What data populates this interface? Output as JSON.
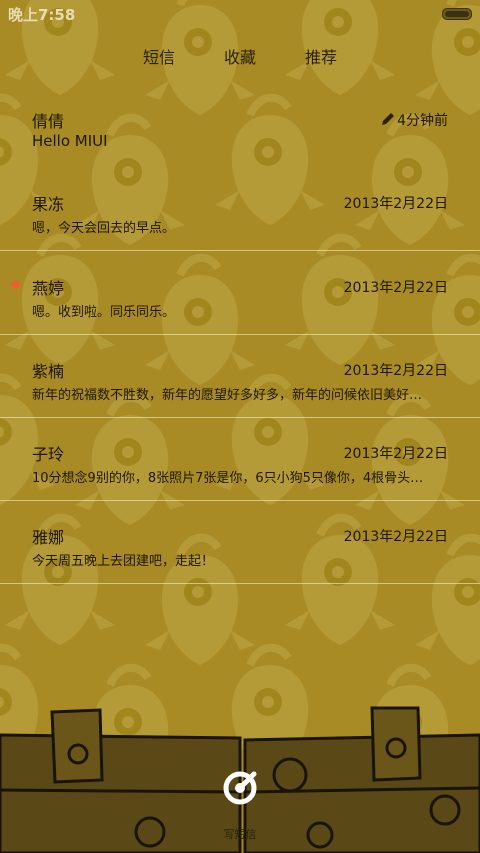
{
  "status_bar": {
    "time": "晚上7:58"
  },
  "tabs": [
    {
      "label": "短信",
      "active": true
    },
    {
      "label": "收藏",
      "active": false
    },
    {
      "label": "推荐",
      "active": false
    }
  ],
  "threads": [
    {
      "name": "倩倩",
      "time": "4分钟前",
      "preview": "Hello MIUI",
      "draft": true,
      "unread": false
    },
    {
      "name": "果冻",
      "time": "2013年2月22日",
      "preview": "嗯，今天会回去的早点。",
      "draft": false,
      "unread": false
    },
    {
      "name": "燕婷",
      "time": "2013年2月22日",
      "preview": "嗯。收到啦。同乐同乐。",
      "draft": false,
      "unread": true
    },
    {
      "name": "紫楠",
      "time": "2013年2月22日",
      "preview": "新年的祝福数不胜数，新年的愿望好多好多，新年的问候依旧美好…",
      "draft": false,
      "unread": false
    },
    {
      "name": "子玲",
      "time": "2013年2月22日",
      "preview": "10分想念9别的你，8张照片7张是你，6只小狗5只像你，4根骨头…",
      "draft": false,
      "unread": false
    },
    {
      "name": "雅娜",
      "time": "2013年2月22日",
      "preview": "今天周五晚上去团建吧，走起！",
      "draft": false,
      "unread": false
    }
  ],
  "compose": {
    "label": "写短信",
    "icon": "compose-icon"
  },
  "colors": {
    "background": "#a88b25",
    "pattern": "#b89d3a",
    "unread": "#e8622a",
    "text": "#1e1705"
  }
}
